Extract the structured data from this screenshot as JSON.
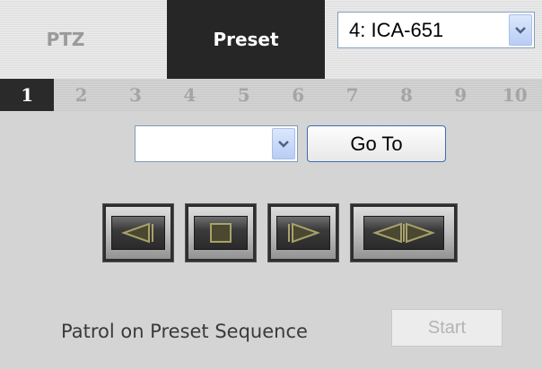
{
  "tabs": {
    "ptz_label": "PTZ",
    "preset_label": "Preset"
  },
  "camera_select": {
    "value": "4: ICA-651"
  },
  "preset_numbers": [
    "1",
    "2",
    "3",
    "4",
    "5",
    "6",
    "7",
    "8",
    "9",
    "10"
  ],
  "active_preset_number": "1",
  "goto": {
    "preset_value": "",
    "button_label": "Go To"
  },
  "controls": {
    "icons": [
      "prev-icon",
      "stop-icon",
      "next-icon",
      "prev-next-icon"
    ]
  },
  "patrol": {
    "label": "Patrol on Preset Sequence",
    "start_label": "Start"
  },
  "colors": {
    "active_tab_bg": "#262626",
    "panel_bg": "#d4d4d4",
    "icon_olive": "#8e8a5a"
  }
}
